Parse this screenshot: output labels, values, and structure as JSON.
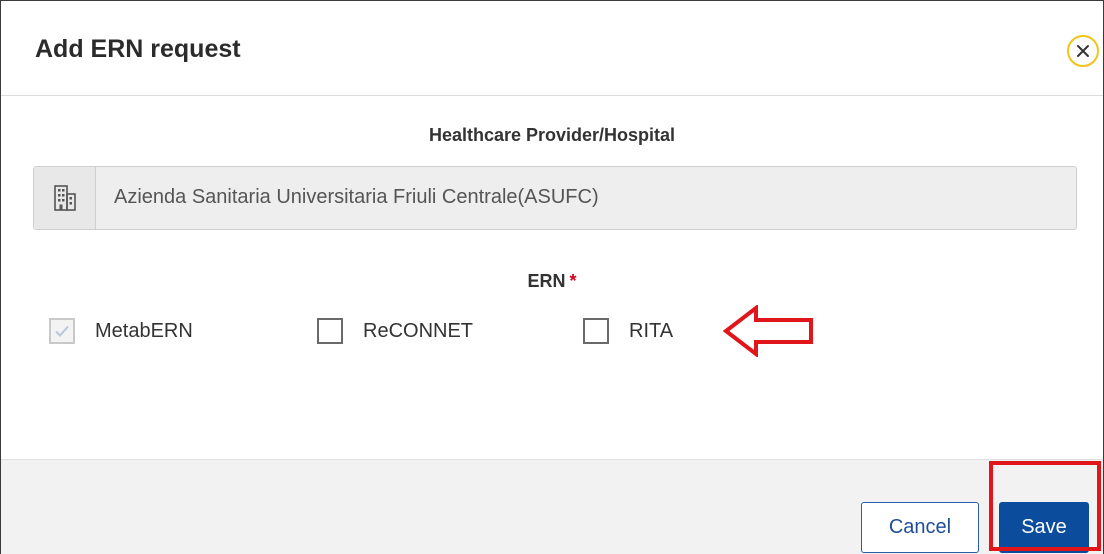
{
  "dialog": {
    "title": "Add ERN request",
    "close_icon": "close-icon",
    "accent_color": "#f0c419"
  },
  "healthcare_provider": {
    "label": "Healthcare Provider/Hospital",
    "icon": "building-icon",
    "value": "Azienda Sanitaria Universitaria Friuli Centrale(ASUFC)"
  },
  "ern": {
    "label": "ERN",
    "required_marker": "*",
    "required_color": "#d0021b",
    "options": [
      {
        "label": "MetabERN",
        "checked": true,
        "disabled": true
      },
      {
        "label": "ReCONNET",
        "checked": false,
        "disabled": false
      },
      {
        "label": "RITA",
        "checked": false,
        "disabled": false
      }
    ]
  },
  "annotations": {
    "arrow_icon": "left-arrow-icon",
    "highlight_color": "#e0161b"
  },
  "footer": {
    "cancel_label": "Cancel",
    "save_label": "Save",
    "primary_color": "#0c4c9c"
  }
}
